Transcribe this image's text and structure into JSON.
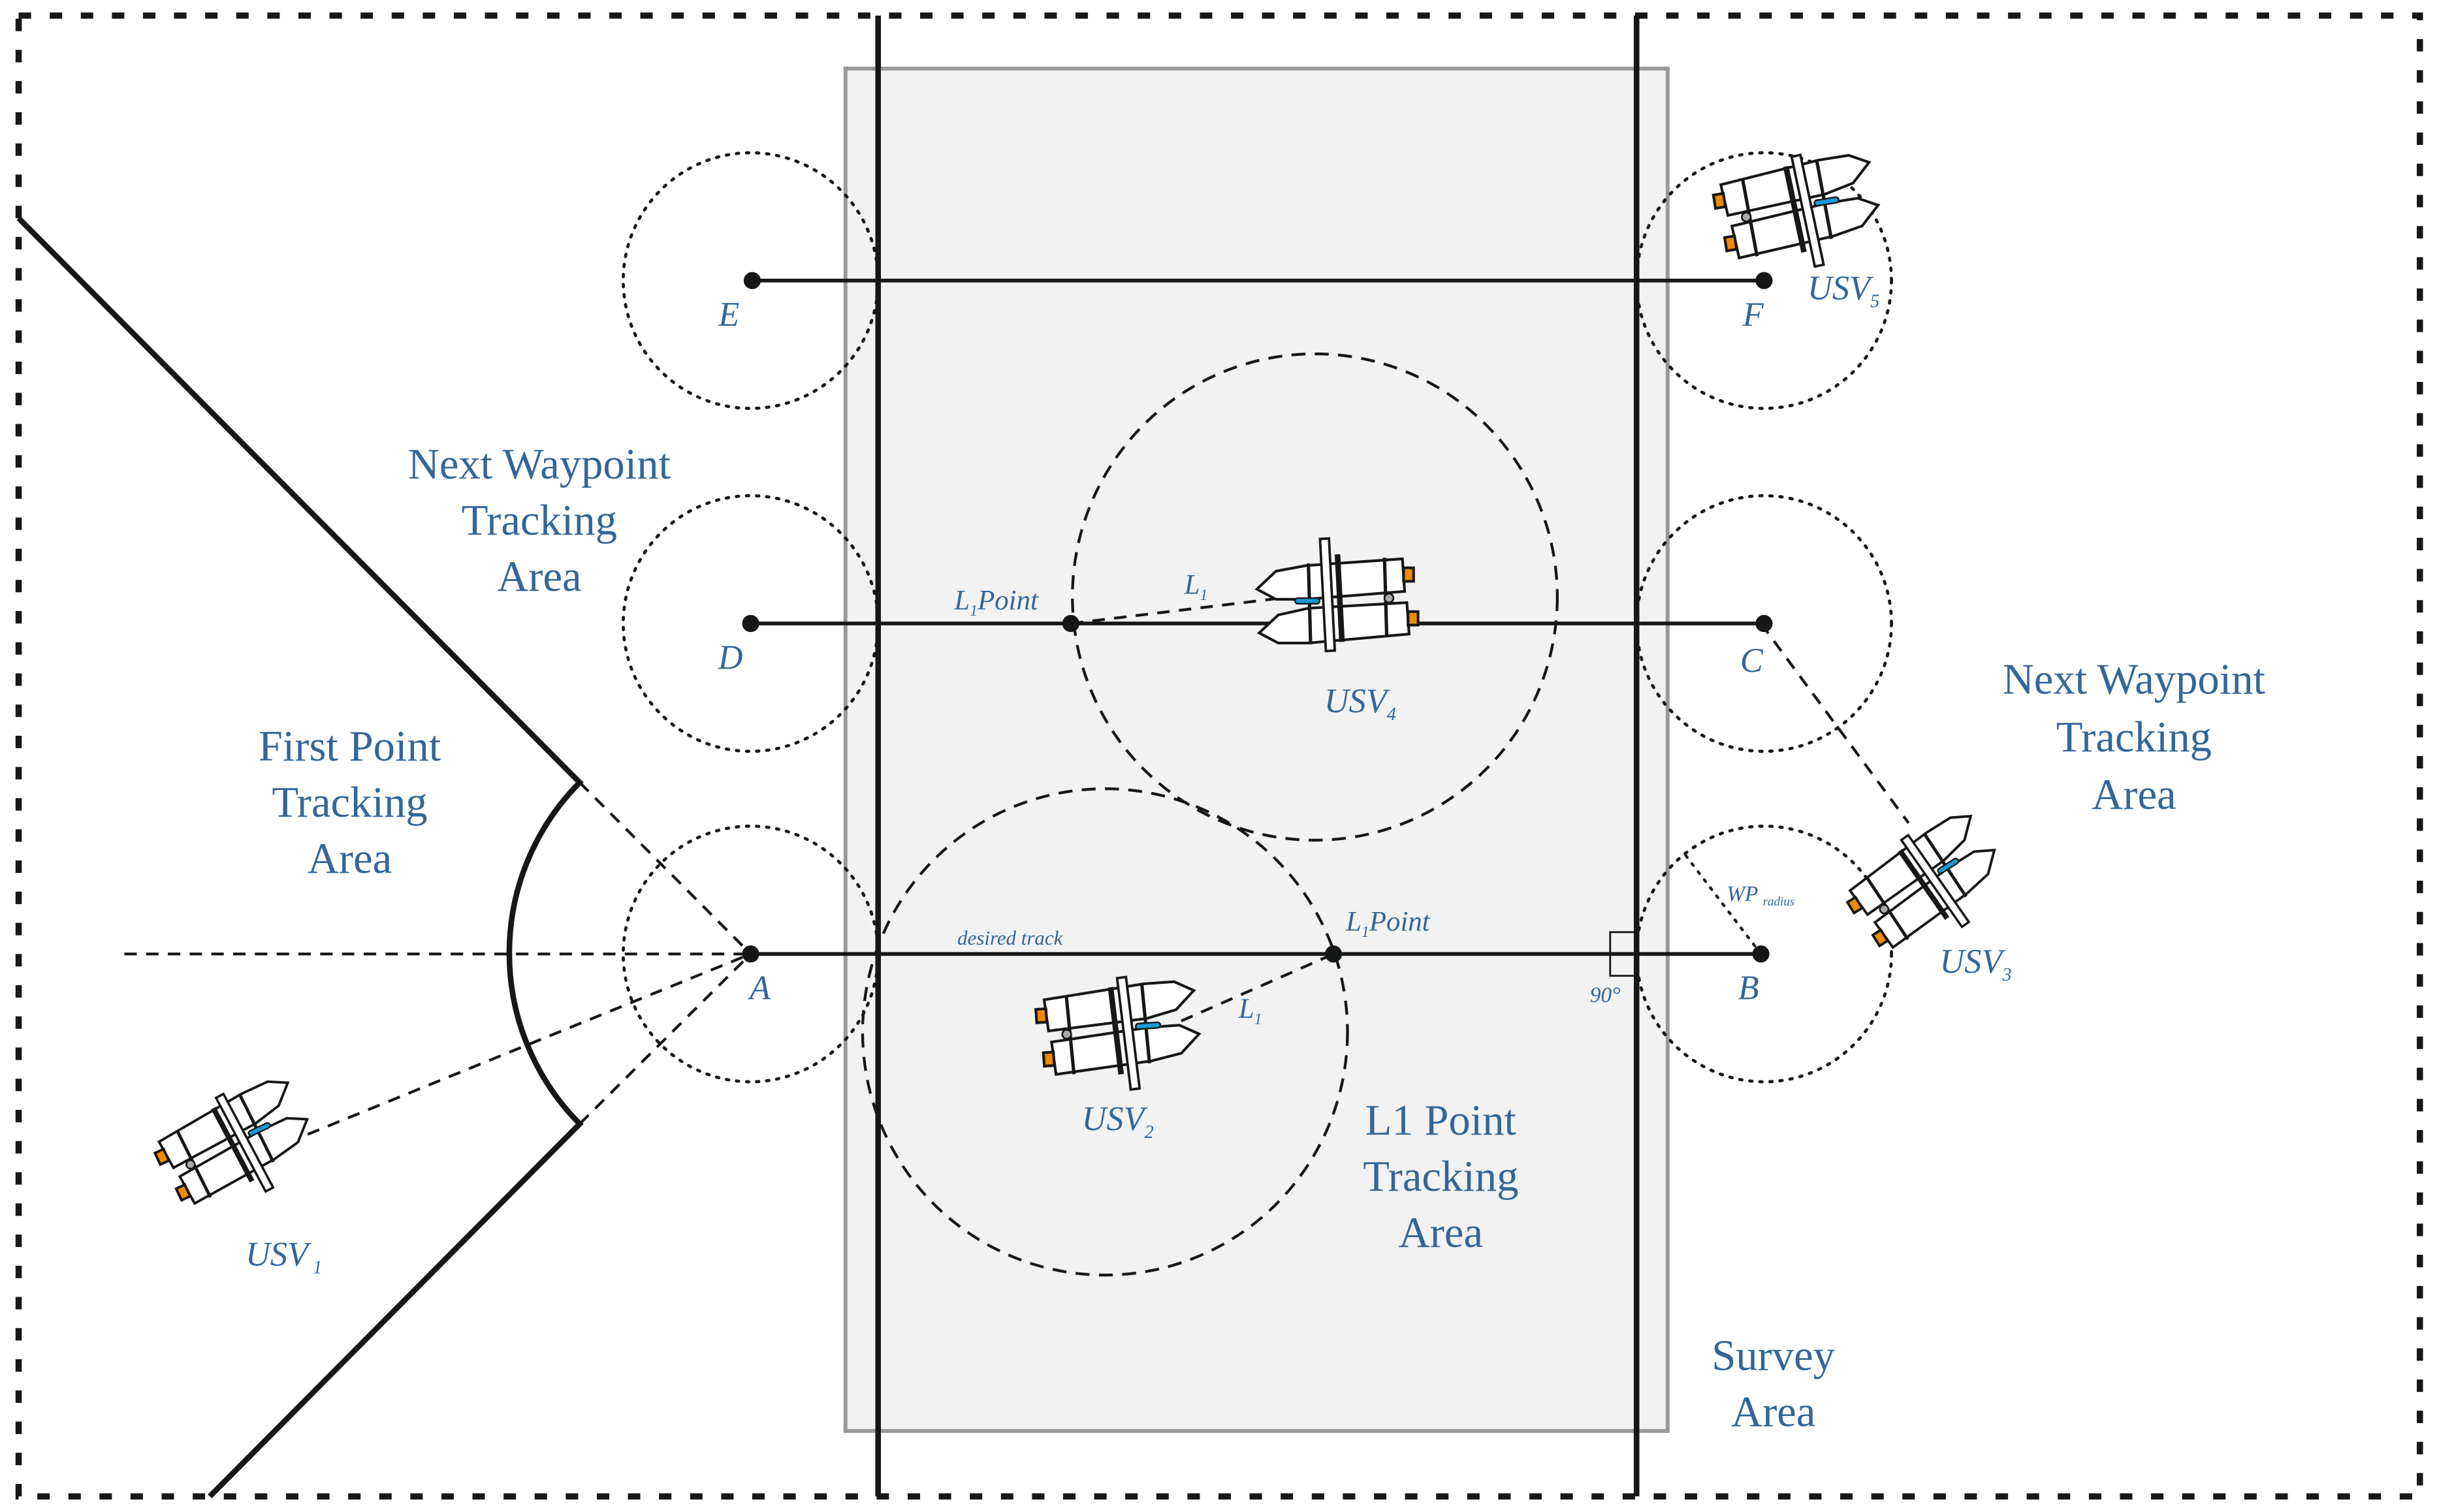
{
  "colors": {
    "label": "#336699",
    "line": "#161817",
    "survey_fill": "#f2f2f2",
    "survey_border": "#999999",
    "thruster": "#f08a00",
    "sensor": "#1a9ad6",
    "hitch": "#aaaaaa"
  },
  "regions": {
    "first_point": [
      "First Point",
      "Tracking",
      "Area"
    ],
    "next_waypoint_left": [
      "Next Waypoint",
      "Tracking",
      "Area"
    ],
    "next_waypoint_right": [
      "Next Waypoint",
      "Tracking",
      "Area"
    ],
    "l1_point": [
      "L1 Point",
      "Tracking",
      "Area"
    ],
    "survey": [
      "Survey",
      "Area"
    ]
  },
  "waypoints": [
    {
      "id": "A",
      "label": "A"
    },
    {
      "id": "B",
      "label": "B"
    },
    {
      "id": "C",
      "label": "C"
    },
    {
      "id": "D",
      "label": "D"
    },
    {
      "id": "E",
      "label": "E"
    },
    {
      "id": "F",
      "label": "F"
    }
  ],
  "annotations": {
    "desired_track": "desired track",
    "l1_point_main": "L",
    "l1_point_sub": "1",
    "l1_point_suffix": "Point",
    "l1_main": "L",
    "l1_sub": "1",
    "wp_radius_main": "WP",
    "wp_radius_sub": "radius",
    "right_angle": "90°"
  },
  "vessels": [
    {
      "id": "usv1",
      "main": "USV",
      "sub": "1"
    },
    {
      "id": "usv2",
      "main": "USV",
      "sub": "2"
    },
    {
      "id": "usv3",
      "main": "USV",
      "sub": "3"
    },
    {
      "id": "usv4",
      "main": "USV",
      "sub": "4"
    },
    {
      "id": "usv5",
      "main": "USV",
      "sub": "5"
    }
  ]
}
